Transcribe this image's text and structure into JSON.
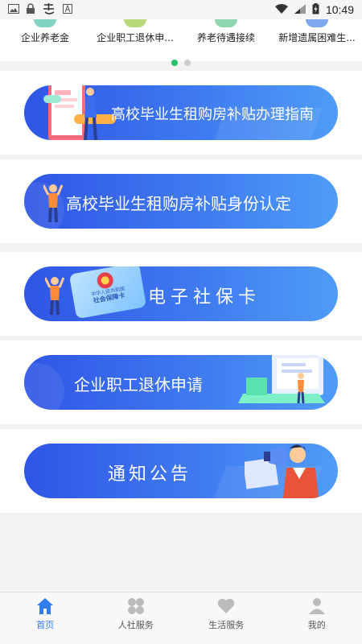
{
  "status_bar": {
    "time": "10:49"
  },
  "quick_items": [
    {
      "label": "企业养老金",
      "color": "#7fd3c0"
    },
    {
      "label": "企业职工退休申...",
      "color": "#b7d97a"
    },
    {
      "label": "养老待遇接续",
      "color": "#8fd6ae"
    },
    {
      "label": "新增遗属困难生...",
      "color": "#7ea8ef"
    }
  ],
  "banners": [
    {
      "text": "高校毕业生租购房补贴办理指南"
    },
    {
      "text": "高校毕业生租购房补贴身份认定"
    },
    {
      "text": "电子社保卡",
      "card_lines": [
        "中华人民共和国",
        "社会保障卡"
      ]
    },
    {
      "text": "企业职工退休申请"
    },
    {
      "text": "通知公告"
    }
  ],
  "tabs": [
    {
      "label": "首页",
      "icon": "home-icon",
      "active": true
    },
    {
      "label": "人社服务",
      "icon": "clover-icon"
    },
    {
      "label": "生活服务",
      "icon": "heart-icon"
    },
    {
      "label": "我的",
      "icon": "user-icon"
    }
  ],
  "colors": {
    "accent": "#2f7bf0",
    "banner_start": "#2f55e6",
    "banner_end": "#4f9cf7",
    "dot_active": "#24c06a"
  }
}
